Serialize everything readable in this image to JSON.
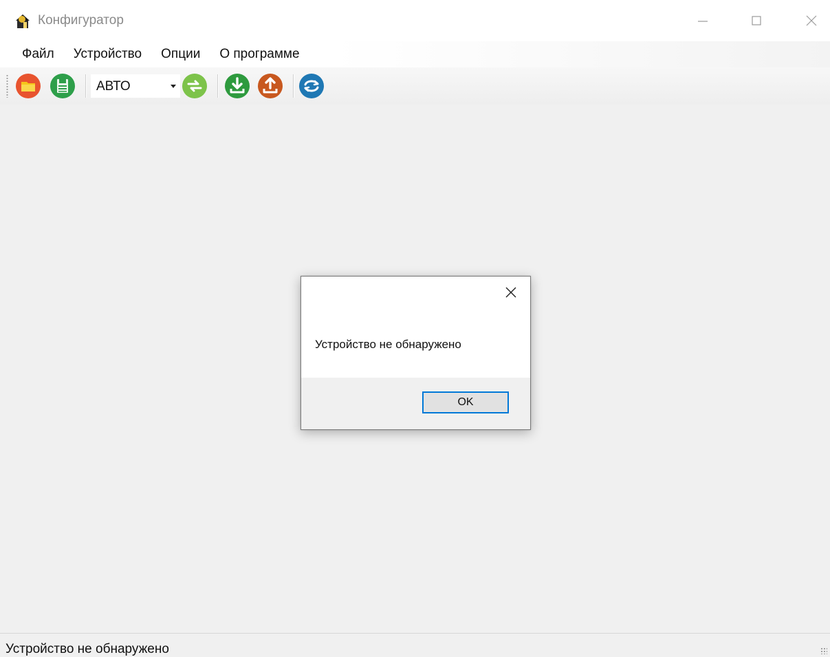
{
  "window": {
    "title": "Конфигуратор"
  },
  "menu": {
    "items": [
      {
        "label": "Файл"
      },
      {
        "label": "Устройство"
      },
      {
        "label": "Опции"
      },
      {
        "label": "О программе"
      }
    ]
  },
  "toolbar": {
    "buttons": [
      {
        "icon": "open-folder-icon",
        "color": "#e8542f"
      },
      {
        "icon": "save-icon",
        "color": "#2e9f4a"
      },
      {
        "icon": "connect-arrows-icon",
        "color": "#7dc34a"
      },
      {
        "icon": "download-icon",
        "color": "#2e9a3e"
      },
      {
        "icon": "upload-icon",
        "color": "#c8581f"
      },
      {
        "icon": "sync-icon",
        "color": "#1f78b4"
      }
    ],
    "port_select": {
      "value": "АВТО"
    }
  },
  "dialog": {
    "message": "Устройство не обнаружено",
    "ok_label": "OK",
    "accent": "#0078d7"
  },
  "status": {
    "text": "Устройство не обнаружено"
  }
}
